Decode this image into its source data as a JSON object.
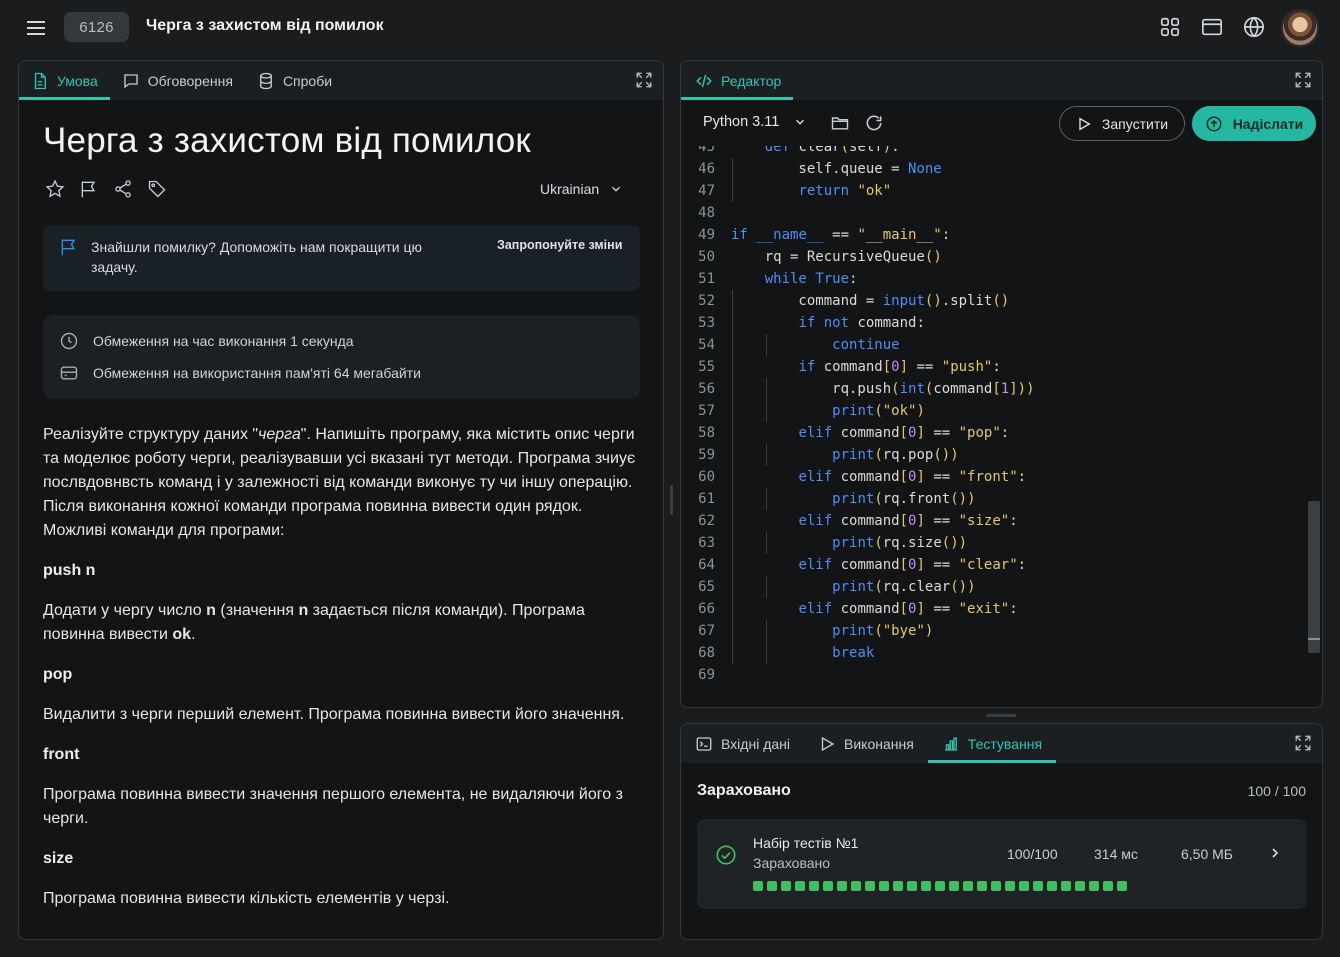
{
  "topbar": {
    "problem_id": "6126",
    "title": "Черга з захистом від помилок",
    "icons": [
      "grid-icon",
      "window-icon",
      "globe-icon"
    ]
  },
  "left_panel": {
    "tabs": [
      {
        "label": "Умова",
        "icon": "document-icon",
        "active": true
      },
      {
        "label": "Обговорення",
        "icon": "chat-icon",
        "active": false
      },
      {
        "label": "Спроби",
        "icon": "database-icon",
        "active": false
      }
    ],
    "heading": "Черга з захистом від помилок",
    "language": "Ukrainian",
    "notice": {
      "message": "Знайшли помилку? Допоможіть нам покращити цю задачу.",
      "link": "Запропонуйте зміни"
    },
    "limits": {
      "time": "Обмеження на час виконання 1 секунда",
      "memory": "Обмеження на використання пам'яті 64 мегабайти"
    },
    "statement": {
      "intro_before": "Реалізуйте структуру даних \"",
      "intro_italic": "черга",
      "intro_after": "\". Напишіть програму, яка містить опис черги та моделює роботу черги, реалізувавши усі вказані тут методи. Програма зчиує послвдовнвсть команд і у залежності від команди виконує ту чи іншу операцію. Після виконання кожної команди програма повинна вивести один рядок. Можливі команди для програми:",
      "cmd_push": "push n",
      "push_desc_1": "Додати у чергу число ",
      "push_desc_n1": "n",
      "push_desc_2": " (значення ",
      "push_desc_n2": "n",
      "push_desc_3": " задається після команди). Програма повинна вивести ",
      "push_desc_ok": "ok",
      "push_desc_4": ".",
      "cmd_pop": "pop",
      "pop_desc": "Видалити з черги перший елемент. Програма повинна вивести його значення.",
      "cmd_front": "front",
      "front_desc": "Програма повинна вивести значення першого елемента, не видаляючи його з черги.",
      "cmd_size": "size",
      "size_desc": "Програма повинна вивести кількість елементів у черзі."
    }
  },
  "editor": {
    "tab_label": "Редактор",
    "python_version": "Python 3.11",
    "run_label": "Запустити",
    "submit_label": "Надіслати",
    "first_line_partial": "    def clear(self):",
    "lines": [
      {
        "n": "45",
        "text": "    def clear(self):"
      },
      {
        "n": "46",
        "text": "        self.queue = None"
      },
      {
        "n": "47",
        "text": "        return \"ok\""
      },
      {
        "n": "48",
        "text": ""
      },
      {
        "n": "49",
        "text": "if __name__ == \"__main__\":"
      },
      {
        "n": "50",
        "text": "    rq = RecursiveQueue()"
      },
      {
        "n": "51",
        "text": "    while True:"
      },
      {
        "n": "52",
        "text": "        command = input().split()"
      },
      {
        "n": "53",
        "text": "        if not command:"
      },
      {
        "n": "54",
        "text": "            continue"
      },
      {
        "n": "55",
        "text": "        if command[0] == \"push\":"
      },
      {
        "n": "56",
        "text": "            rq.push(int(command[1]))"
      },
      {
        "n": "57",
        "text": "            print(\"ok\")"
      },
      {
        "n": "58",
        "text": "        elif command[0] == \"pop\":"
      },
      {
        "n": "59",
        "text": "            print(rq.pop())"
      },
      {
        "n": "60",
        "text": "        elif command[0] == \"front\":"
      },
      {
        "n": "61",
        "text": "            print(rq.front())"
      },
      {
        "n": "62",
        "text": "        elif command[0] == \"size\":"
      },
      {
        "n": "63",
        "text": "            print(rq.size())"
      },
      {
        "n": "64",
        "text": "        elif command[0] == \"clear\":"
      },
      {
        "n": "65",
        "text": "            print(rq.clear())"
      },
      {
        "n": "66",
        "text": "        elif command[0] == \"exit\":"
      },
      {
        "n": "67",
        "text": "            print(\"bye\")"
      },
      {
        "n": "68",
        "text": "            break"
      },
      {
        "n": "69",
        "text": ""
      }
    ]
  },
  "bottom_panel": {
    "tabs": [
      {
        "label": "Вхідні дані",
        "icon": "terminal-icon",
        "active": false
      },
      {
        "label": "Виконання",
        "icon": "play-icon",
        "active": false
      },
      {
        "label": "Тестування",
        "icon": "bar-chart-icon",
        "active": true
      }
    ],
    "result_title": "Зараховано",
    "result_score": "100 / 100",
    "test": {
      "name": "Набір тестів №1",
      "status": "Зараховано",
      "score": "100/100",
      "time": "314 мс",
      "memory": "6,50 МБ",
      "passed_count": 27
    }
  },
  "colors": {
    "accent": "#2ec4b0",
    "success": "#3fbf60",
    "background": "#1a1c1e"
  }
}
